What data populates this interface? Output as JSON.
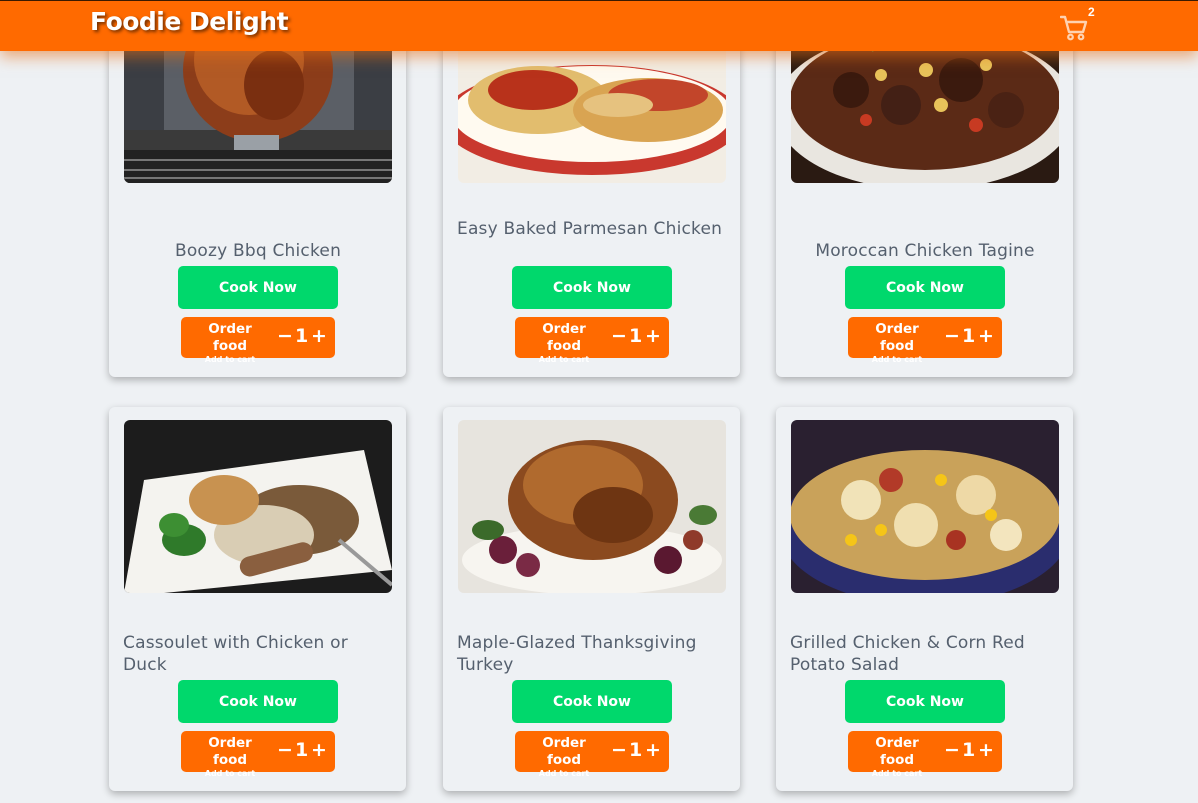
{
  "header": {
    "brand": "Foodie Delight",
    "cart_count": "2",
    "cart_icon": "shopping-cart-icon"
  },
  "labels": {
    "cook_now": "Cook Now",
    "order_food": "Order food",
    "add_to_cart": "Add to cart",
    "minus": "−",
    "plus": "+"
  },
  "recipes": [
    {
      "title": "Boozy Bbq Chicken",
      "quantity": "1"
    },
    {
      "title": "Easy Baked Parmesan Chicken",
      "quantity": "1"
    },
    {
      "title": "Moroccan Chicken Tagine",
      "quantity": "1"
    },
    {
      "title": "Cassoulet with Chicken or Duck",
      "quantity": "1"
    },
    {
      "title": "Maple-Glazed Thanksgiving Turkey",
      "quantity": "1"
    },
    {
      "title": "Grilled Chicken & Corn Red Potato Salad",
      "quantity": "1"
    }
  ],
  "colors": {
    "brand": "#ff6a00",
    "cook_button": "#00d86c",
    "background": "#eef1f4",
    "title_text": "#55606e"
  }
}
